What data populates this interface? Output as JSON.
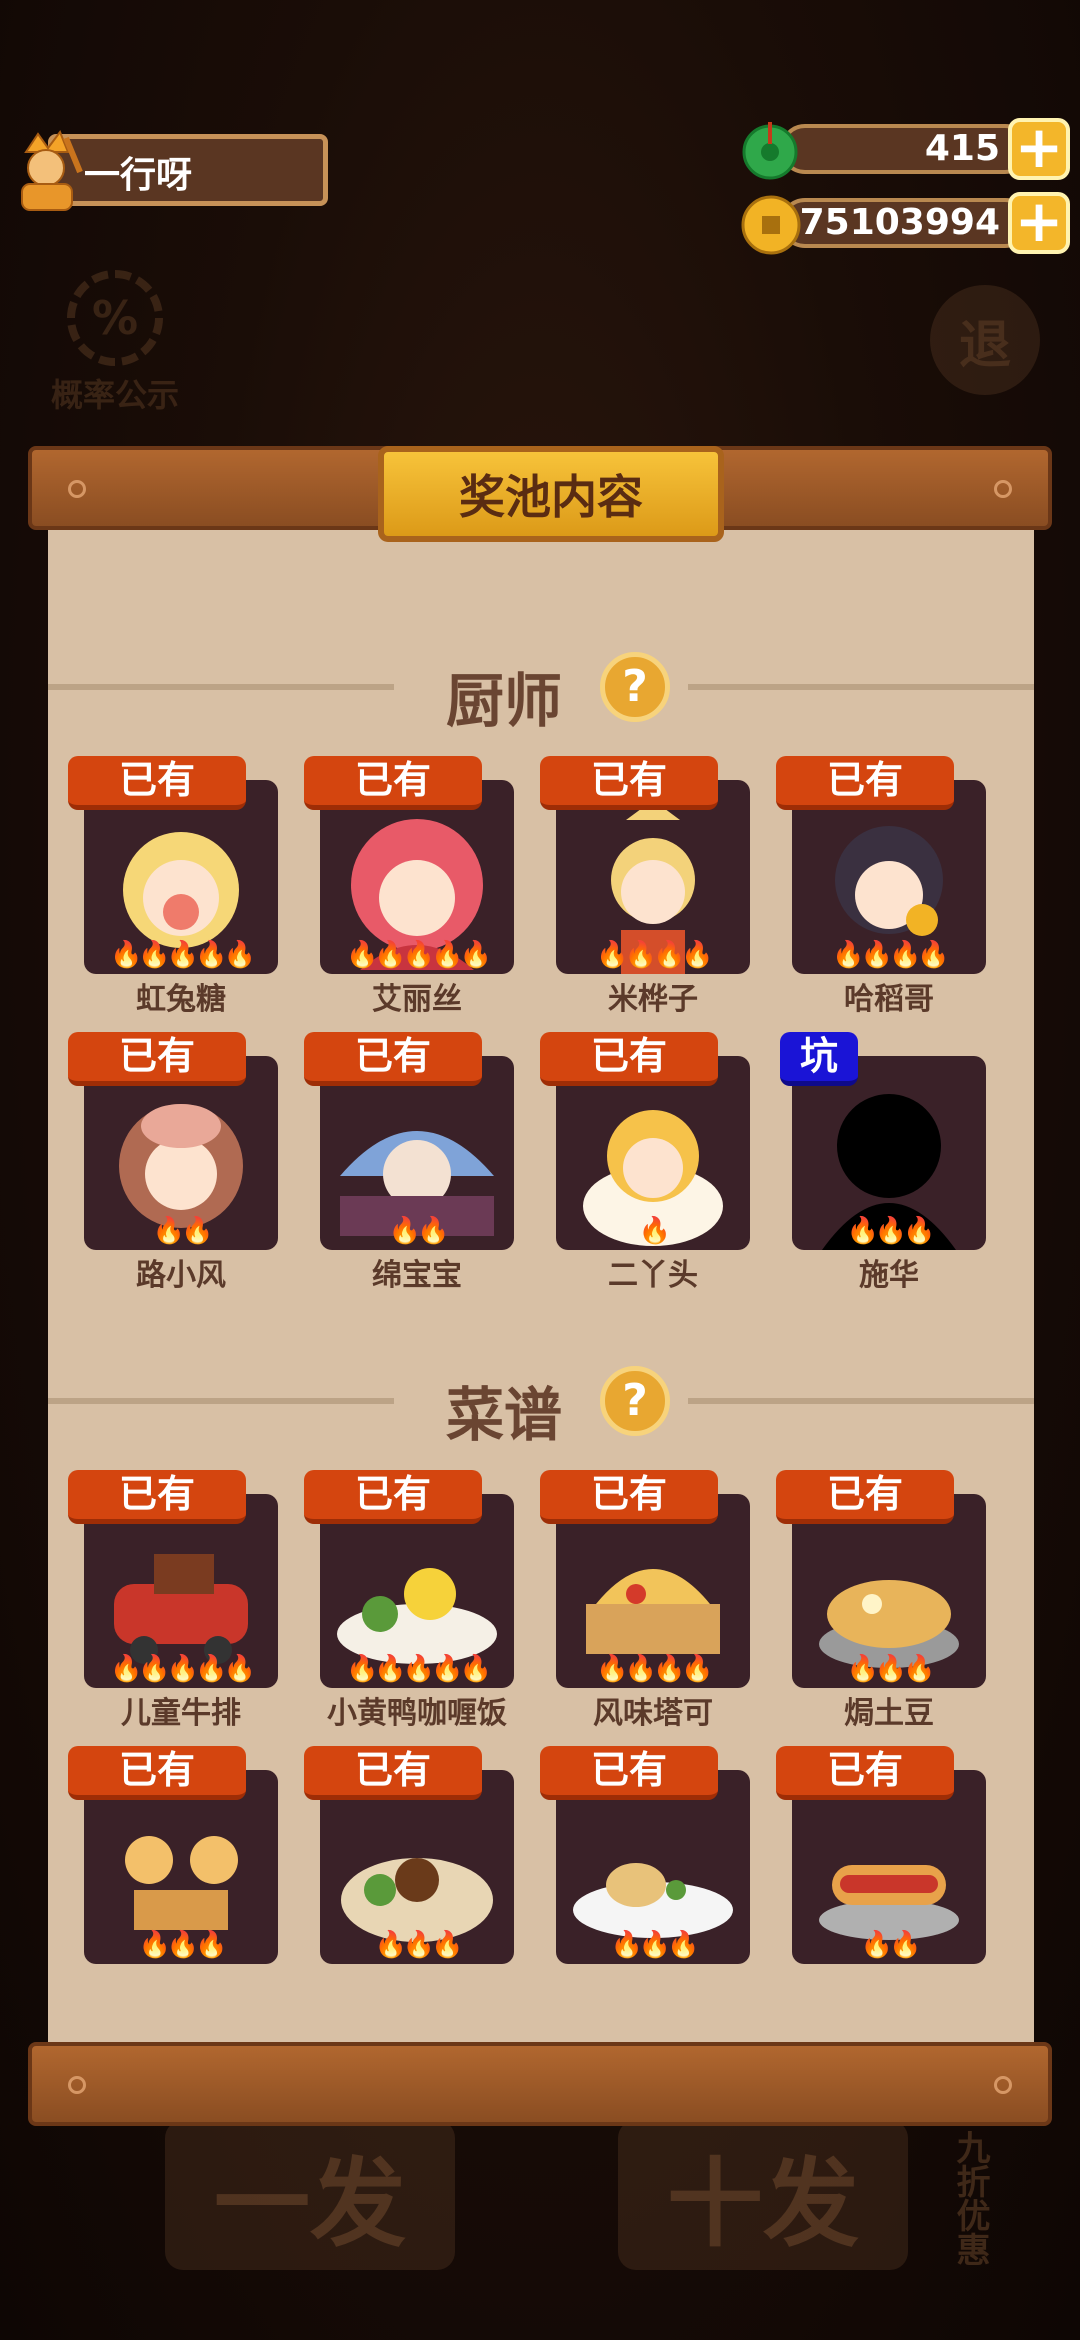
{
  "profile": {
    "name": "一行呀"
  },
  "resources": {
    "jade": "415",
    "coins": "75103994",
    "plus": "+"
  },
  "background": {
    "probability_label": "概率公示",
    "exit_label": "退",
    "single_draw": "一发",
    "ten_draw": "十发",
    "discount": "九折优惠"
  },
  "panel": {
    "title": "奖池内容"
  },
  "chefs_section": {
    "title": "厨师",
    "help": "?",
    "items": [
      {
        "name": "虹兔糖",
        "tag": "已有",
        "stars": 5
      },
      {
        "name": "艾丽丝",
        "tag": "已有",
        "stars": 5
      },
      {
        "name": "米桦子",
        "tag": "已有",
        "stars": 4
      },
      {
        "name": "哈稻哥",
        "tag": "已有",
        "stars": 4
      },
      {
        "name": "路小风",
        "tag": "已有",
        "stars": 2
      },
      {
        "name": "绵宝宝",
        "tag": "已有",
        "stars": 2
      },
      {
        "name": "二丫头",
        "tag": "已有",
        "stars": 1
      },
      {
        "name": "施华",
        "tag": "坑",
        "stars": 3
      }
    ]
  },
  "recipes_section": {
    "title": "菜谱",
    "help": "?",
    "items": [
      {
        "name": "儿童牛排",
        "tag": "已有",
        "stars": 5
      },
      {
        "name": "小黄鸭咖喱饭",
        "tag": "已有",
        "stars": 5
      },
      {
        "name": "风味塔可",
        "tag": "已有",
        "stars": 4
      },
      {
        "name": "焗土豆",
        "tag": "已有",
        "stars": 3
      },
      {
        "name": "",
        "tag": "已有",
        "stars": 3
      },
      {
        "name": "",
        "tag": "已有",
        "stars": 3
      },
      {
        "name": "",
        "tag": "已有",
        "stars": 3
      },
      {
        "name": "",
        "tag": "已有",
        "stars": 2
      }
    ]
  },
  "colors": {
    "tag_owned": "#d4450f",
    "tag_pit": "#1a14d6",
    "panel_bg": "#d8c0a5",
    "flame": "#f06a12"
  }
}
